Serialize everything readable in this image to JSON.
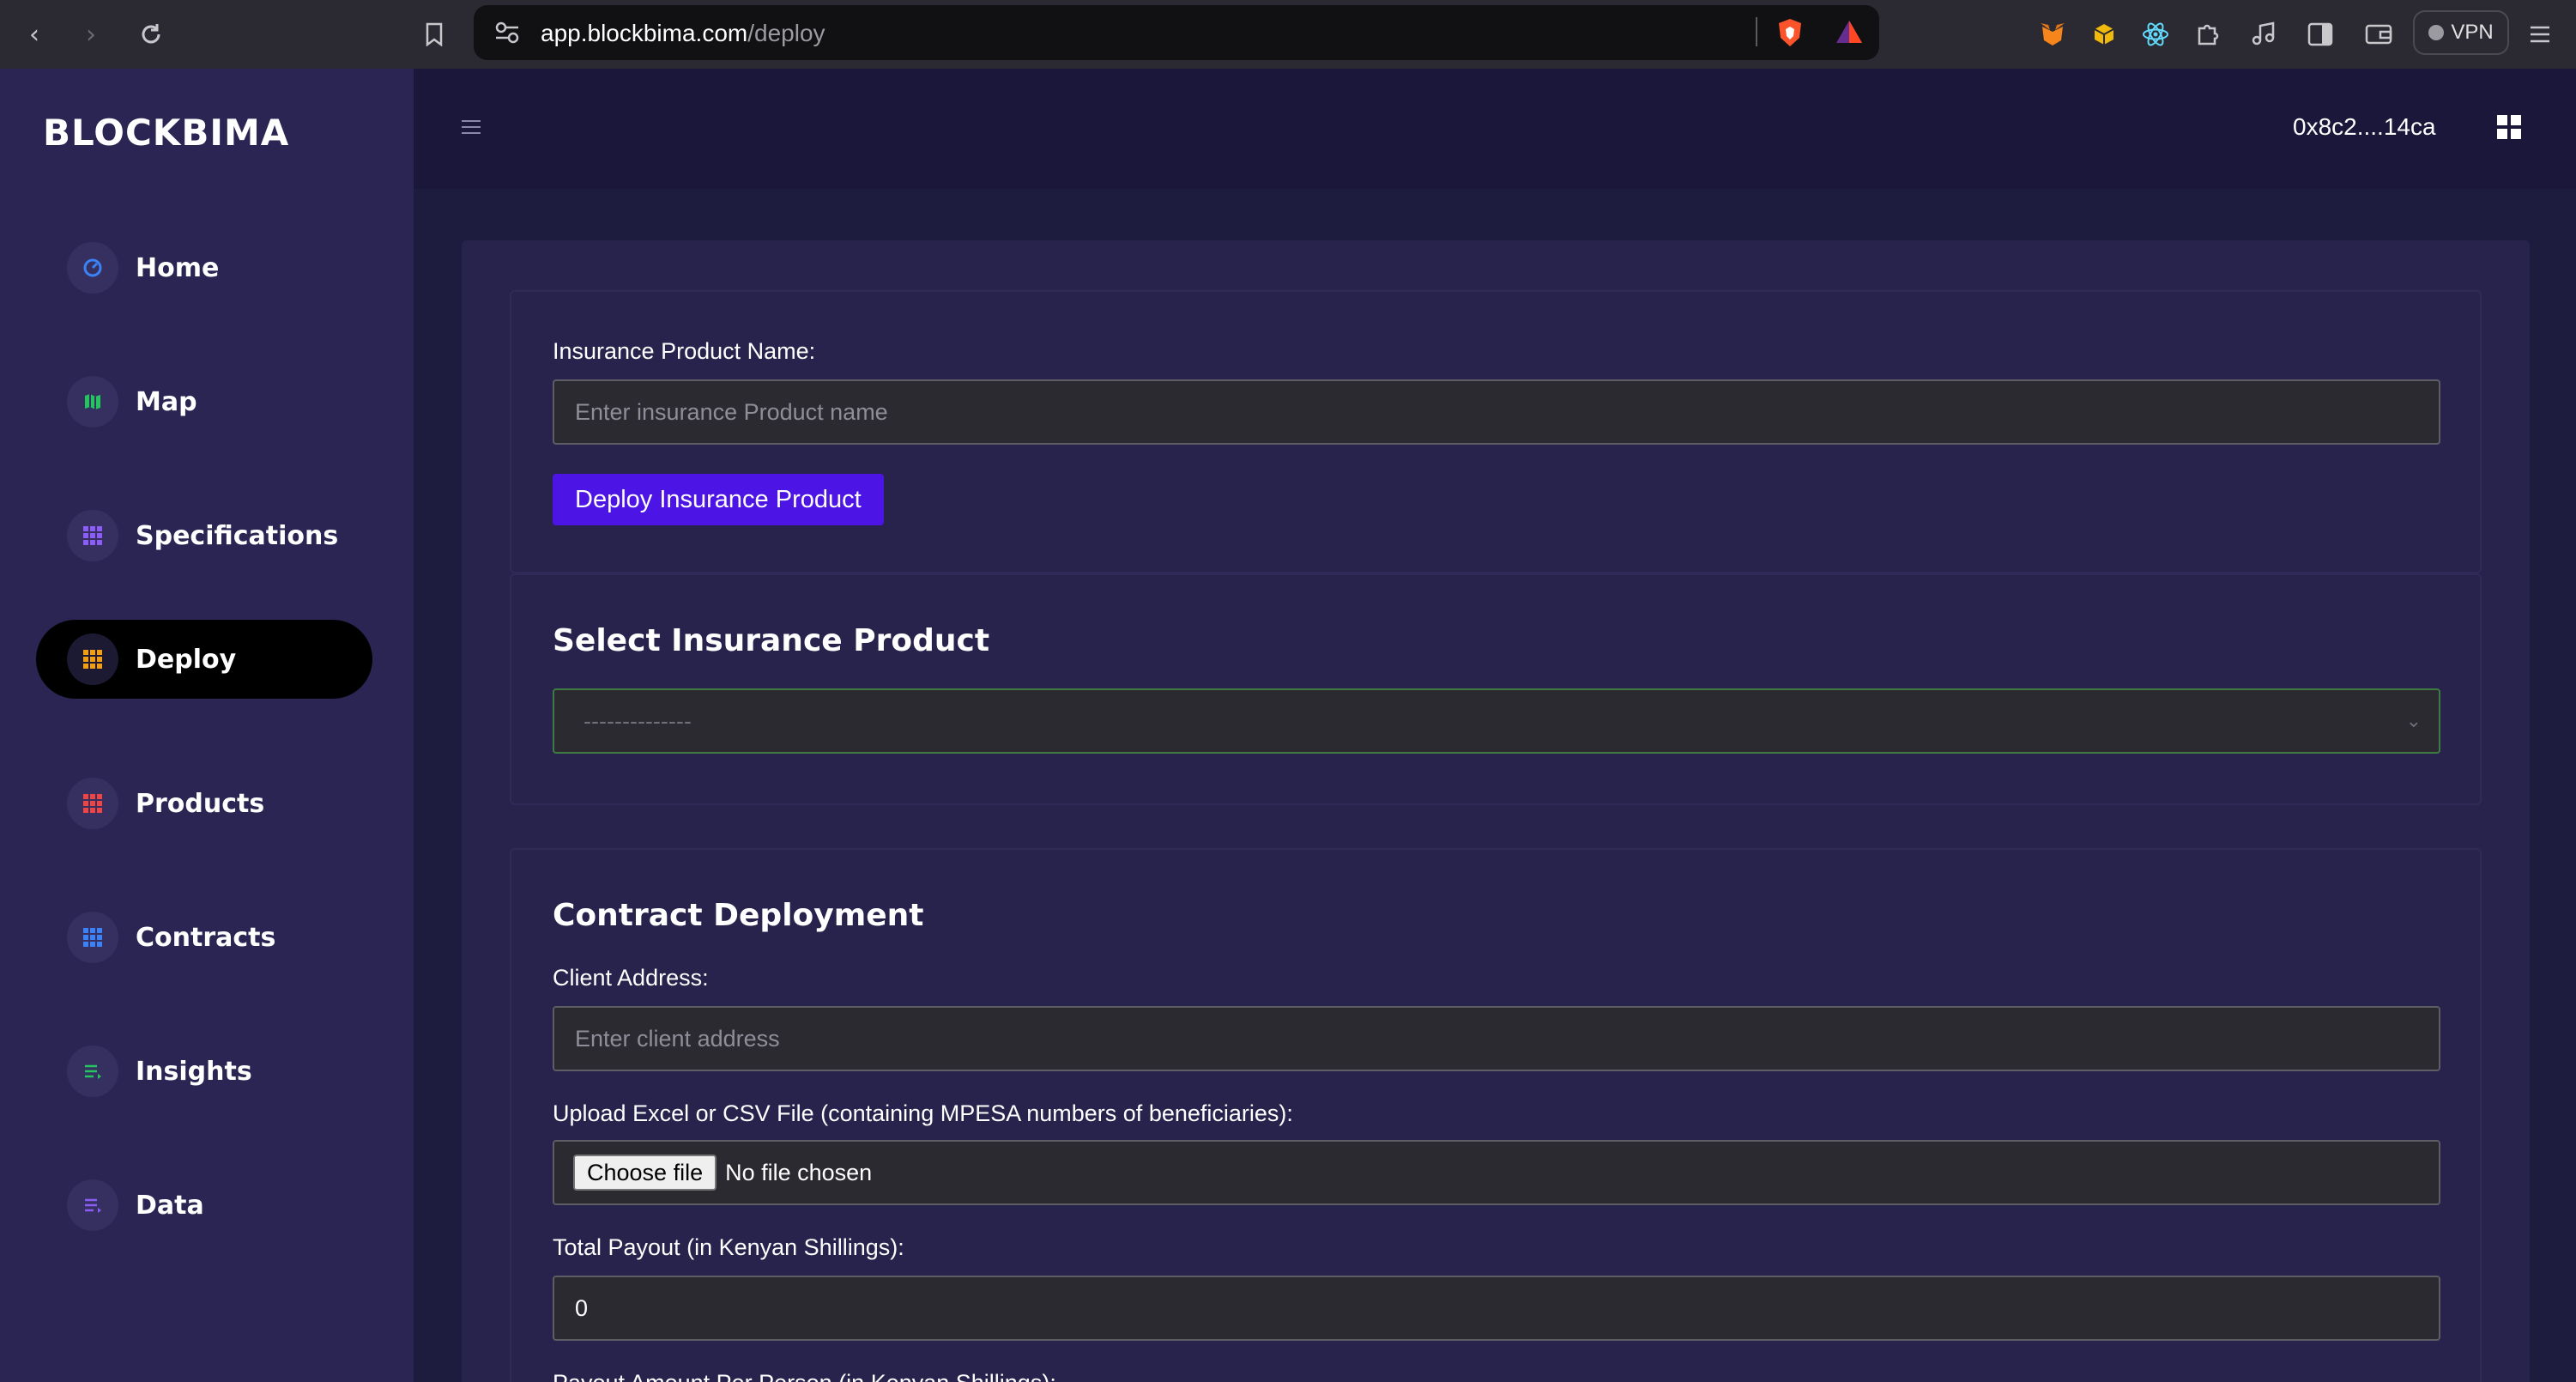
{
  "browser": {
    "url_host": "app.blockbima.com",
    "url_path": "/deploy",
    "vpn_label": "VPN"
  },
  "sidebar": {
    "logo": "BLOCKBIMA",
    "items": [
      {
        "label": "Home",
        "icon": "gauge-icon",
        "color": "#3b82f6"
      },
      {
        "label": "Map",
        "icon": "map-icon",
        "color": "#22c55e"
      },
      {
        "label": "Specifications",
        "icon": "table-icon",
        "color": "#8b5cf6"
      },
      {
        "label": "Deploy",
        "icon": "table-icon",
        "color": "#f59e0b"
      },
      {
        "label": "Products",
        "icon": "table-icon",
        "color": "#ef4444"
      },
      {
        "label": "Contracts",
        "icon": "table-icon",
        "color": "#3b82f6"
      },
      {
        "label": "Insights",
        "icon": "list-icon",
        "color": "#22c55e"
      },
      {
        "label": "Data",
        "icon": "list-icon",
        "color": "#8b5cf6"
      }
    ],
    "active_index": 3
  },
  "topbar": {
    "wallet_address": "0x8c2....14ca"
  },
  "product_form": {
    "name_label": "Insurance Product Name:",
    "name_placeholder": "Enter insurance Product name",
    "deploy_button": "Deploy Insurance Product"
  },
  "select_product": {
    "heading": "Select Insurance Product",
    "selected_value": "--------------"
  },
  "contract": {
    "heading": "Contract Deployment",
    "client_label": "Client Address:",
    "client_placeholder": "Enter client address",
    "upload_label": "Upload Excel or CSV File (containing MPESA numbers of beneficiaries):",
    "choose_file": "Choose file",
    "no_file": "No file chosen",
    "total_label": "Total Payout (in Kenyan Shillings):",
    "total_value": "0",
    "per_person_label": "Payout Amount Per Person (in Kenyan Shillings):"
  },
  "colors": {
    "accent_button": "#4d14e6",
    "sidebar_bg": "#2a2552",
    "main_bg": "#1d1b3e"
  }
}
